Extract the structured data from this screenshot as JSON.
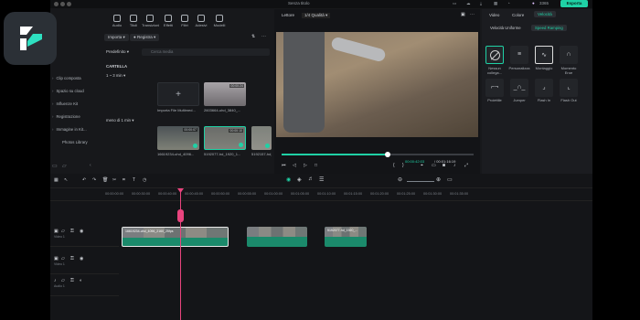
{
  "window": {
    "title": "Senza titolo",
    "credits": "3365",
    "export_label": "Esporta"
  },
  "top_toolbar": [
    {
      "label": "Audio"
    },
    {
      "label": "Titoli"
    },
    {
      "label": "Transizioni"
    },
    {
      "label": "Effetti"
    },
    {
      "label": "Filtri"
    },
    {
      "label": "Adesivi"
    },
    {
      "label": "Modelli"
    }
  ],
  "sidebar": {
    "items": [
      "Clip composta",
      "Spazio su cloud",
      "Influenze Kit",
      "Registrazione",
      "Immagine in Kit..."
    ],
    "library": "Photos Library"
  },
  "media": {
    "import_label": "Importa",
    "record_label": "Registra",
    "default_label": "Predefinito",
    "search_placeholder": "Cerca media",
    "folder_label": "CARTELLA",
    "group1": "1 ~ 3 min",
    "group2": "meno di 1 min",
    "import_tile_label": "Importa File Multimed...",
    "items": [
      {
        "label": "2603664-uhd_3840_...",
        "duration": "00:00:24"
      },
      {
        "label": "16619234-uhd_4096...",
        "duration": "00:00:07"
      },
      {
        "label": "5192077-hd_1920_1...",
        "duration": "00:00:10"
      },
      {
        "label": "5192157-hd_1920_1...",
        "duration": "00:00:09"
      }
    ]
  },
  "preview": {
    "player_label": "Lettore",
    "quality": "1/4 Qualità",
    "current_time": "00:00:42:03",
    "total_time": "00:01:16:19",
    "progress": 0.55
  },
  "speed_panel": {
    "tabs": [
      "Video",
      "Colore",
      "Velocità"
    ],
    "active_tab": "Velocità",
    "mode_tabs": [
      "Velocità Uniforme",
      "Speed Ramping"
    ],
    "active_mode": "Speed Ramping",
    "presets_row1": [
      "Nessun collega...",
      "Personalizza",
      "Montaggio",
      "Momento Eroe"
    ],
    "presets_row2": [
      "Proiettile",
      "Jumper",
      "Flash In",
      "Flash Out"
    ]
  },
  "timeline": {
    "ruler": [
      "00:00:00:00",
      "00:00:30:00",
      "00:00:40:00",
      "00:00:45:00",
      "00:00:50:00",
      "00:00:55:00",
      "00:01:00:00",
      "00:01:05:00",
      "00:01:10:00",
      "00:01:15:00",
      "00:01:20:00",
      "00:01:25:00",
      "00:01:30:00",
      "00:01:35:00"
    ],
    "tracks": [
      {
        "label": "Video 1"
      },
      {
        "label": "Video 1"
      },
      {
        "label": "Audio 1"
      }
    ],
    "clips": [
      {
        "label": "16619234-uhd_4096_2160_25fps"
      },
      {
        "label": ""
      },
      {
        "label": "5192077-hd_1920_..."
      }
    ]
  },
  "colors": {
    "accent": "#1fd1a5",
    "playhead": "#e9447e",
    "clip": "#1b8a6b"
  }
}
